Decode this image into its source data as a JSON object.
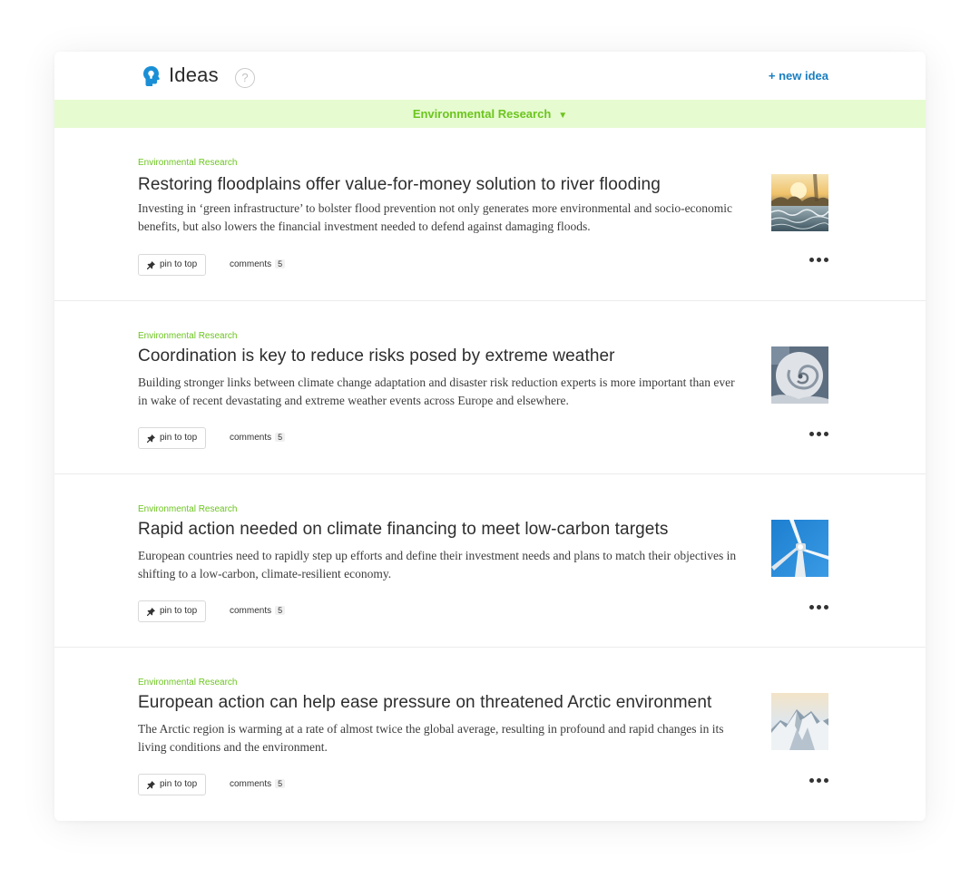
{
  "header": {
    "title": "Ideas",
    "help_label": "?",
    "new_idea_label": "+ new idea"
  },
  "filter": {
    "selected": "Environmental Research",
    "caret": "▼"
  },
  "items": [
    {
      "category": "Environmental Research",
      "title": "Restoring floodplains offer value-for-money solution to river flooding",
      "description": "Investing in ‘green infrastructure’ to bolster flood prevention not only generates more environmental and socio-economic benefits, but also lowers the financial investment needed to defend against damaging floods.",
      "pin_label": "pin to top",
      "comments_label": "comments",
      "comments_count": "5",
      "thumbnail": "river-sunset-image"
    },
    {
      "category": "Environmental Research",
      "title": "Coordination is key to reduce risks posed by extreme weather",
      "description": "Building stronger links between climate change adaptation and disaster risk reduction experts is more important than ever in wake of recent devastating and extreme weather events across Europe and elsewhere.",
      "pin_label": "pin to top",
      "comments_label": "comments",
      "comments_count": "5",
      "thumbnail": "hurricane-satellite-image"
    },
    {
      "category": "Environmental Research",
      "title": "Rapid action needed on climate financing to meet low-carbon targets",
      "description": "European countries need to rapidly step up efforts and define their investment needs and plans to match their objectives in shifting to a low-carbon, climate-resilient economy.",
      "pin_label": "pin to top",
      "comments_label": "comments",
      "comments_count": "5",
      "thumbnail": "wind-turbine-image"
    },
    {
      "category": "Environmental Research",
      "title": "European action can help ease pressure on threatened Arctic environment",
      "description": "The Arctic region is warming at a rate of almost twice the global average, resulting in profound and rapid changes in its living conditions and the environment.",
      "pin_label": "pin to top",
      "comments_label": "comments",
      "comments_count": "5",
      "thumbnail": "snowy-mountain-image"
    }
  ],
  "colors": {
    "accent_green": "#6cc51e",
    "filter_bg": "#e6fbd0",
    "link_blue": "#1a7fc1",
    "brand_icon": "#1a8fd6"
  }
}
